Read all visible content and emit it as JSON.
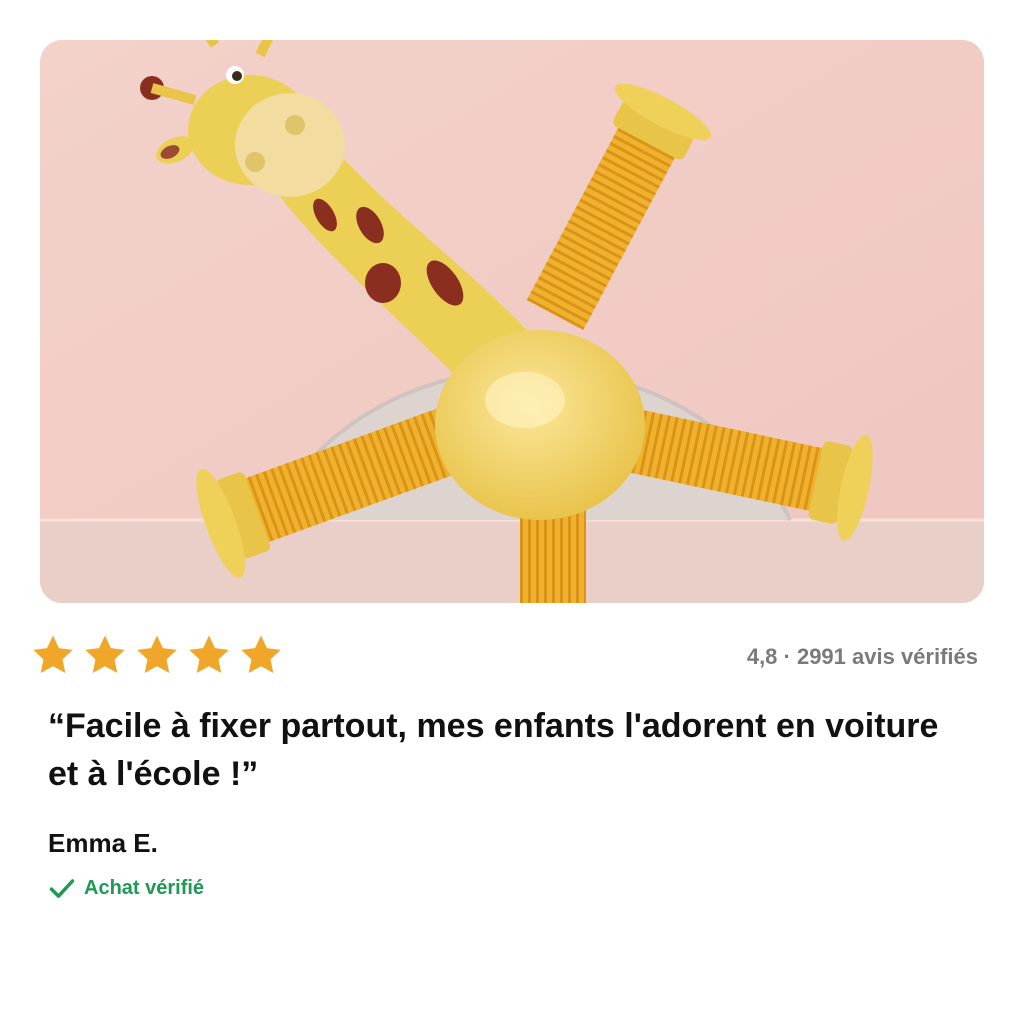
{
  "product_image": {
    "icon": "giraffe-suction-toy-photo",
    "background_color": "#f1cfc8"
  },
  "rating": {
    "stars": 5,
    "star_color": "#f0a629",
    "summary": "4,8 · 2991 avis vérifiés"
  },
  "review": {
    "quote": "“Facile à fixer partout, mes enfants l'adorent en voiture et à l'école !”",
    "author": "Emma E.",
    "verified_label": "Achat vérifié",
    "verified_color": "#1f9a55"
  }
}
